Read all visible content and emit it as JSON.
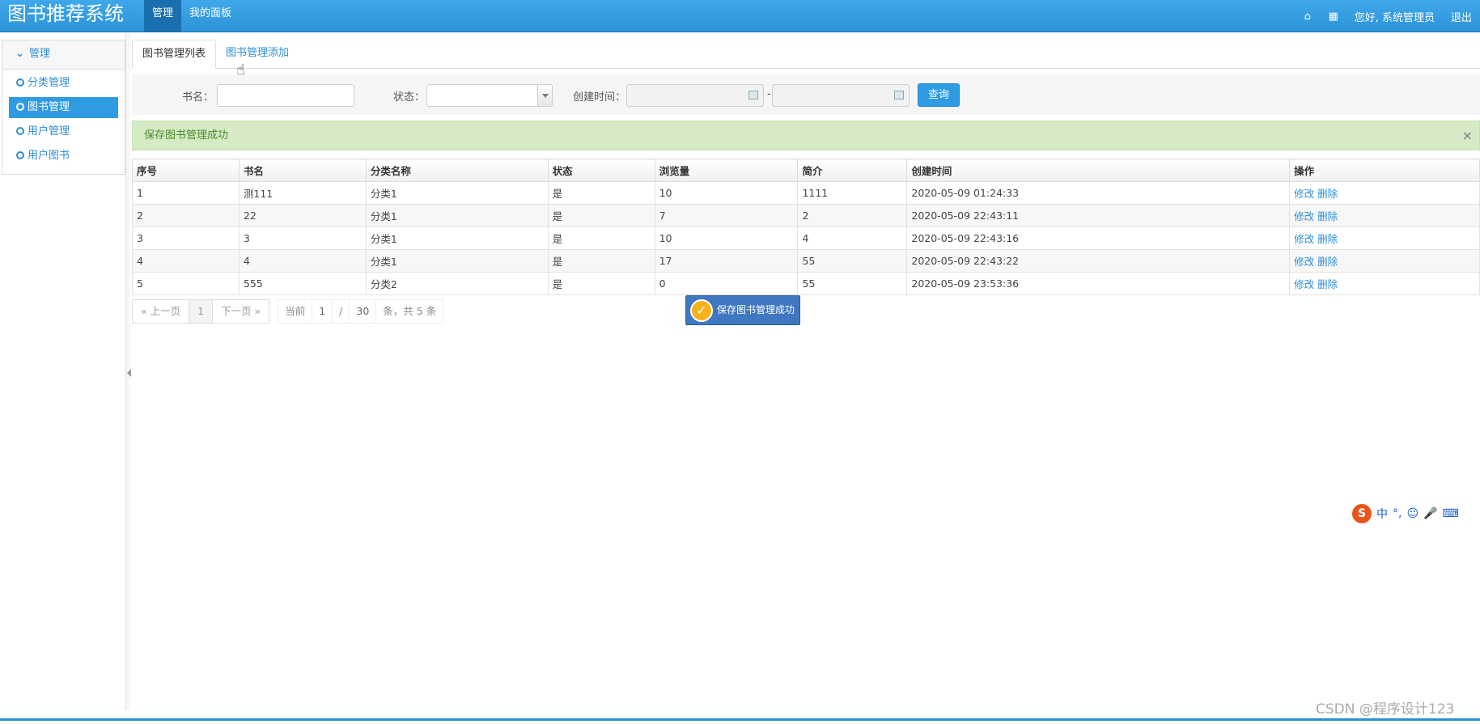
{
  "app": {
    "title": "图书推荐系统"
  },
  "topnav": [
    {
      "label": "管理"
    },
    {
      "label": "我的面板"
    }
  ],
  "topright": {
    "home_icon": "home-icon",
    "apps_icon": "grid-icon",
    "greeting": "您好, 系统管理员",
    "logout": "退出"
  },
  "sidebar": {
    "header": "管理",
    "items": [
      {
        "label": "分类管理"
      },
      {
        "label": "图书管理"
      },
      {
        "label": "用户管理"
      },
      {
        "label": "用户图书"
      }
    ]
  },
  "tabs": [
    {
      "label": "图书管理列表"
    },
    {
      "label": "图书管理添加"
    }
  ],
  "search": {
    "name_label": "书名：",
    "status_label": "状态：",
    "created_label": "创建时间：",
    "range_sep": "-",
    "query_button": "查询"
  },
  "alert": {
    "message": "保存图书管理成功",
    "close": "×"
  },
  "table": {
    "columns": [
      "序号",
      "书名",
      "分类名称",
      "状态",
      "浏览量",
      "简介",
      "创建时间",
      "操作"
    ],
    "rows": [
      [
        "1",
        "测111",
        "分类1",
        "是",
        "10",
        "1111",
        "2020-05-09 01:24:33"
      ],
      [
        "2",
        "22",
        "分类1",
        "是",
        "7",
        "2",
        "2020-05-09 22:43:11"
      ],
      [
        "3",
        "3",
        "分类1",
        "是",
        "10",
        "4",
        "2020-05-09 22:43:16"
      ],
      [
        "4",
        "4",
        "分类1",
        "是",
        "17",
        "55",
        "2020-05-09 22:43:22"
      ],
      [
        "5",
        "555",
        "分类2",
        "是",
        "0",
        "55",
        "2020-05-09 23:53:36"
      ]
    ],
    "edit_label": "修改",
    "delete_label": "删除"
  },
  "pager": {
    "prev": "« 上一页",
    "current_page": "1",
    "next": "下一页 »",
    "info_prefix": "当前",
    "page": "1",
    "slash": "/",
    "page_size": "30",
    "info_suffix": "条，共 5 条"
  },
  "toast": {
    "message": "保存图书管理成功"
  },
  "ime": {
    "logo": "S",
    "mode": "中",
    "punct": "°,",
    "emoji": "☺",
    "mic": "🎤",
    "kbd": "⌨"
  },
  "watermark": "CSDN @程序设计123"
}
